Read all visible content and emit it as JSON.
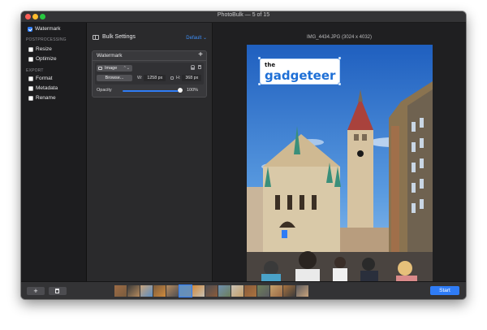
{
  "window": {
    "title": "PhotoBulk — 5 of 15"
  },
  "sidebar": {
    "items_top": [
      {
        "label": "Watermark",
        "checked": true
      }
    ],
    "sections": [
      {
        "title": "POSTPROCESSING",
        "items": [
          {
            "label": "Resize",
            "checked": false
          },
          {
            "label": "Optimize",
            "checked": false
          }
        ]
      },
      {
        "title": "EXPORT",
        "items": [
          {
            "label": "Format",
            "checked": false
          },
          {
            "label": "Metadata",
            "checked": false
          },
          {
            "label": "Rename",
            "checked": false
          }
        ]
      }
    ]
  },
  "settings": {
    "header": "Bulk Settings",
    "preset": "Default ⌄",
    "watermark_panel": {
      "title": "Watermark",
      "add_symbol": "+",
      "type_value": "Image",
      "type_arrows": "⌃⌄",
      "browse_label": "Browse...",
      "width_label": "W:",
      "width_value": "1258 px",
      "height_label": "H:",
      "height_value": "368 px",
      "opacity_label": "Opacity",
      "opacity_value": "100%",
      "opacity_fraction": 1.0
    }
  },
  "preview": {
    "caption": "IMG_4434.JPG (3024 x 4032)",
    "watermark_text_top": "the",
    "watermark_text_main": "gadgeteer"
  },
  "bottom": {
    "add_label": "+",
    "start_label": "Start",
    "thumbnail_count": 15,
    "selected_index": 5
  },
  "colors": {
    "accent": "#2f7cf6",
    "sky": "#2f6fc9",
    "watermark_blue": "#1e6fd6"
  }
}
